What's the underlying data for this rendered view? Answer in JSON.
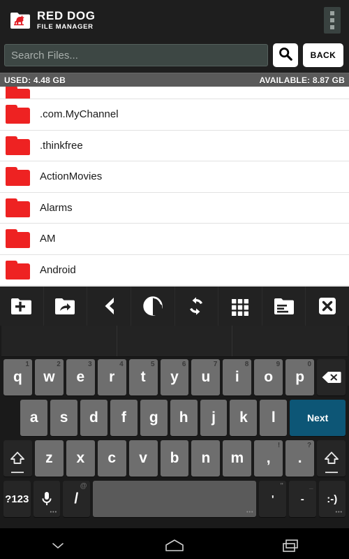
{
  "app": {
    "brand_title": "RED DOG",
    "brand_subtitle": "FILE MANAGER",
    "logo_icon": "red-dog-folder-logo",
    "overflow_icon": "overflow-menu-icon",
    "accent_color": "#ee2222",
    "header_bg": "#1e1e1e"
  },
  "search": {
    "placeholder": "Search Files...",
    "value": "",
    "search_icon": "search-icon",
    "back_label": "BACK"
  },
  "storage": {
    "used_label": "USED: 4.48 GB",
    "available_label": "AVAILABLE: 8.87 GB"
  },
  "files": {
    "clipped_top_item": {
      "name": "",
      "icon": "folder-icon"
    },
    "items": [
      {
        "name": ".com.MyChannel",
        "icon": "folder-icon"
      },
      {
        "name": ".thinkfree",
        "icon": "folder-icon"
      },
      {
        "name": "ActionMovies",
        "icon": "folder-icon"
      },
      {
        "name": "Alarms",
        "icon": "folder-icon"
      },
      {
        "name": "AM",
        "icon": "folder-icon"
      },
      {
        "name": "Android",
        "icon": "folder-icon"
      }
    ]
  },
  "toolbar": {
    "items": [
      {
        "icon": "new-folder-icon",
        "label": "New Folder"
      },
      {
        "icon": "folder-share-icon",
        "label": "Share"
      },
      {
        "icon": "back-chevron-icon",
        "label": "Back"
      },
      {
        "icon": "search-circle-icon",
        "label": "Search"
      },
      {
        "icon": "refresh-icon",
        "label": "Refresh"
      },
      {
        "icon": "grid-view-icon",
        "label": "Grid View"
      },
      {
        "icon": "folder-details-icon",
        "label": "Details"
      },
      {
        "icon": "close-icon",
        "label": "Close"
      }
    ]
  },
  "keyboard": {
    "suggestions": [
      "",
      "",
      ""
    ],
    "row1": [
      {
        "key": "q",
        "hint": "1"
      },
      {
        "key": "w",
        "hint": "2"
      },
      {
        "key": "e",
        "hint": "3"
      },
      {
        "key": "r",
        "hint": "4"
      },
      {
        "key": "t",
        "hint": "5"
      },
      {
        "key": "y",
        "hint": "6"
      },
      {
        "key": "u",
        "hint": "7"
      },
      {
        "key": "i",
        "hint": "8"
      },
      {
        "key": "o",
        "hint": "9"
      },
      {
        "key": "p",
        "hint": "0"
      }
    ],
    "backspace_icon": "backspace-icon",
    "row2": [
      {
        "key": "a"
      },
      {
        "key": "s"
      },
      {
        "key": "d"
      },
      {
        "key": "f"
      },
      {
        "key": "g"
      },
      {
        "key": "h"
      },
      {
        "key": "j"
      },
      {
        "key": "k"
      },
      {
        "key": "l"
      }
    ],
    "enter_label": "Next",
    "row3": [
      {
        "key": "z"
      },
      {
        "key": "x"
      },
      {
        "key": "c"
      },
      {
        "key": "v"
      },
      {
        "key": "b"
      },
      {
        "key": "n"
      },
      {
        "key": "m"
      },
      {
        "key": ",",
        "hint": "!"
      },
      {
        "key": ".",
        "hint": "?"
      }
    ],
    "shift_icon": "shift-icon",
    "row4": {
      "symbols_label": "?123",
      "mic_icon": "microphone-icon",
      "slash_key": "/",
      "slash_hint": "@",
      "space_label": "",
      "apostrophe_key": "'",
      "apostrophe_hint": "\"",
      "dash_key": "-",
      "dash_hint": "_",
      "emoji_key": ":-)"
    }
  },
  "navbar": {
    "back_icon": "hide-keyboard-chevron-icon",
    "home_icon": "home-icon",
    "recents_icon": "recent-apps-icon"
  }
}
